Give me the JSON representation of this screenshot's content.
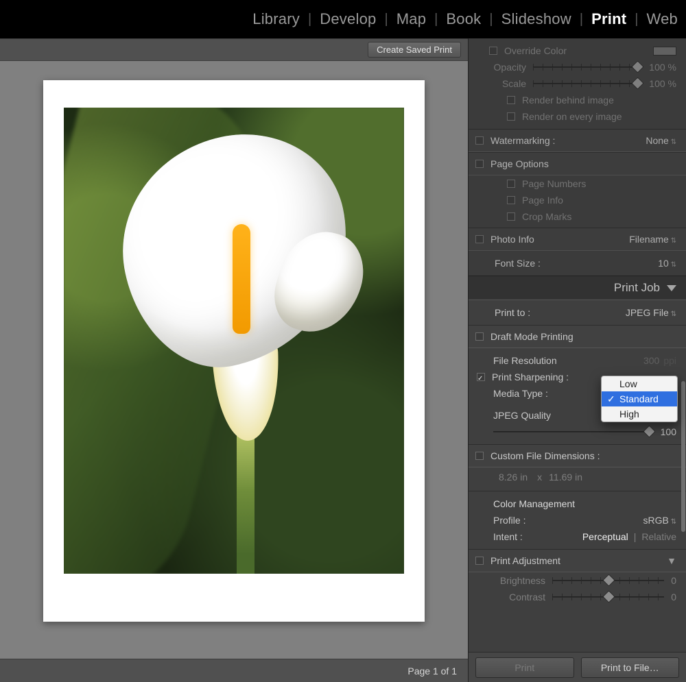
{
  "modules": {
    "library": "Library",
    "develop": "Develop",
    "map": "Map",
    "book": "Book",
    "slideshow": "Slideshow",
    "print": "Print",
    "web": "Web"
  },
  "toolbar": {
    "create_saved_print": "Create Saved Print"
  },
  "footer": {
    "page_indicator": "Page 1 of 1"
  },
  "panel": {
    "override_color": "Override Color",
    "opacity_label": "Opacity",
    "opacity_value": "100 %",
    "scale_label": "Scale",
    "scale_value": "100 %",
    "render_behind": "Render behind image",
    "render_every": "Render on every image",
    "watermarking": "Watermarking :",
    "watermarking_value": "None",
    "page_options": "Page Options",
    "page_numbers": "Page Numbers",
    "page_info": "Page Info",
    "crop_marks": "Crop Marks",
    "photo_info": "Photo Info",
    "photo_info_value": "Filename",
    "font_size": "Font Size :",
    "font_size_value": "10",
    "print_job_header": "Print Job",
    "print_to": "Print to :",
    "print_to_value": "JPEG File",
    "draft_mode": "Draft Mode Printing",
    "file_resolution": "File Resolution",
    "file_resolution_value": "300",
    "file_resolution_unit": "ppi",
    "print_sharpening": "Print Sharpening :",
    "media_type": "Media Type :",
    "jpeg_quality": "JPEG Quality",
    "jpeg_quality_value": "100",
    "custom_dims": "Custom File Dimensions :",
    "custom_w": "8.26",
    "custom_wu": "in",
    "custom_x": "x",
    "custom_h": "11.69",
    "custom_hu": "in",
    "color_mgmt": "Color Management",
    "profile": "Profile :",
    "profile_value": "sRGB",
    "intent": "Intent :",
    "intent_perceptual": "Perceptual",
    "intent_relative": "Relative",
    "print_adjustment": "Print Adjustment",
    "brightness": "Brightness",
    "brightness_value": "0",
    "contrast": "Contrast",
    "contrast_value": "0"
  },
  "dropdown": {
    "low": "Low",
    "standard": "Standard",
    "high": "High"
  },
  "buttons": {
    "print": "Print",
    "print_to_file": "Print to File…"
  }
}
